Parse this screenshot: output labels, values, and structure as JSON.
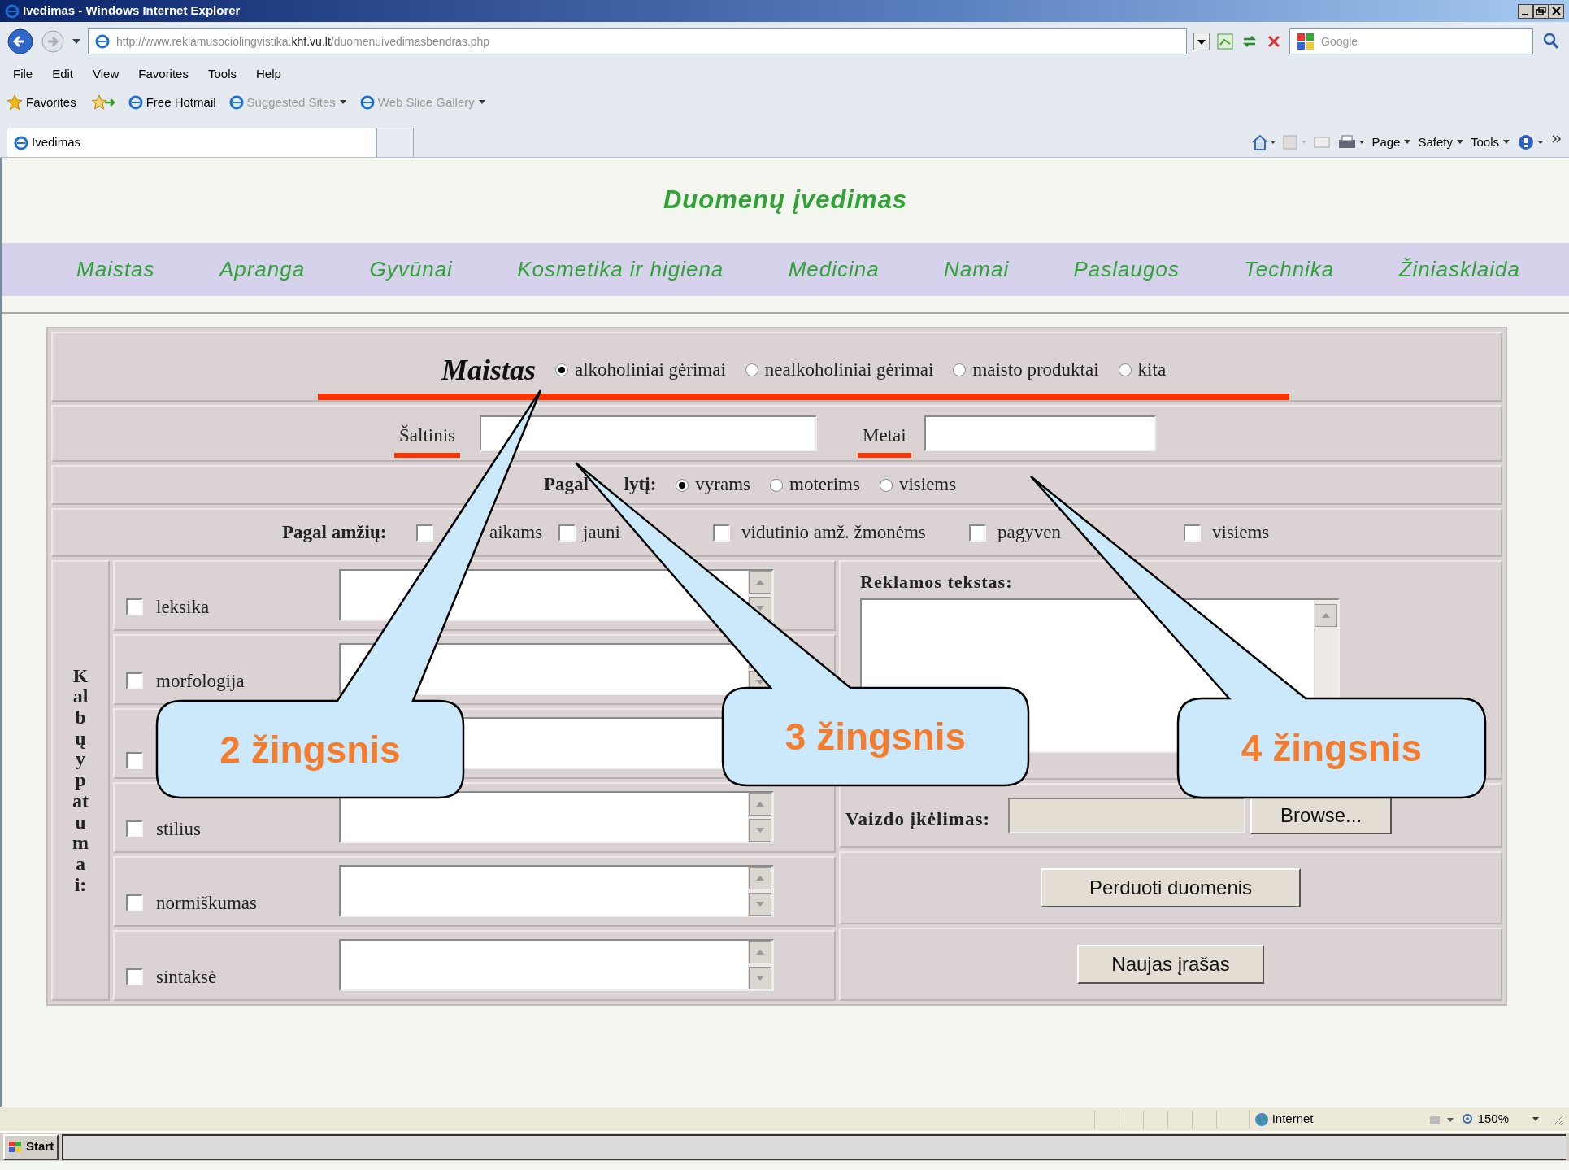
{
  "window": {
    "title": "Ivedimas - Windows Internet Explorer"
  },
  "address_bar": {
    "url": "http://www.reklamusociolingvistika.**khf.vu.lt**/duomenuivedimasbendras.php"
  },
  "search_field": {
    "placeholder": "Google"
  },
  "menu": [
    "File",
    "Edit",
    "View",
    "Favorites",
    "Tools",
    "Help"
  ],
  "favorites_bar": {
    "label": "Favorites",
    "links": [
      {
        "label": "Free Hotmail",
        "dimmed": false,
        "dropdown": false
      },
      {
        "label": "Suggested Sites",
        "dimmed": true,
        "dropdown": true
      },
      {
        "label": "Web Slice Gallery",
        "dimmed": true,
        "dropdown": true
      }
    ]
  },
  "tab": {
    "title": "Ivedimas"
  },
  "command_bar": [
    "Page",
    "Safety",
    "Tools"
  ],
  "page": {
    "heading": "Duomenų įvedimas",
    "nav": [
      "Maistas",
      "Apranga",
      "Gyvūnai",
      "Kosmetika ir higiena",
      "Medicina",
      "Namai",
      "Paslaugos",
      "Technika",
      "Žiniasklaida"
    ],
    "category": "Maistas",
    "category_options": [
      {
        "label": "alkoholiniai gėrimai",
        "selected": true
      },
      {
        "label": "nealkoholiniai gėrimai",
        "selected": false
      },
      {
        "label": "maisto produktai",
        "selected": false
      },
      {
        "label": "kita",
        "selected": false
      }
    ],
    "source_label": "Šaltinis",
    "year_label": "Metai",
    "gender": {
      "label": "Pagal lytį:",
      "options": [
        {
          "label": "vyrams",
          "selected": true
        },
        {
          "label": "moterims",
          "selected": false
        },
        {
          "label": "visiems",
          "selected": false
        }
      ]
    },
    "age": {
      "label": "Pagal amžių:",
      "options": [
        {
          "label": "aikams",
          "checked": false
        },
        {
          "label": "jauni",
          "checked": false
        },
        {
          "label": "vidutinio amž. žmonėms",
          "checked": false
        },
        {
          "label": "pagyven",
          "checked": false
        },
        {
          "label": "visiems",
          "checked": false
        }
      ]
    },
    "features": {
      "label": "Kalbų ypatumai:",
      "items": [
        {
          "label": "leksika",
          "checked": false
        },
        {
          "label": "morfologija",
          "checked": false
        },
        {
          "checked": false
        },
        {
          "label": "stilius",
          "checked": false
        },
        {
          "label": "normiškumas",
          "checked": false
        },
        {
          "label": "sintaksė",
          "checked": false
        }
      ]
    },
    "ad_text": {
      "label": "Reklamos tekstas:"
    },
    "upload": {
      "label": "Vaizdo įkėlimas:",
      "button": "Browse..."
    },
    "buttons": [
      "Perduoti duomenis",
      "Naujas įrašas"
    ]
  },
  "callouts": [
    {
      "label": "2 žingsnis"
    },
    {
      "label": "3 žingsnis"
    },
    {
      "label": "4 žingsnis"
    }
  ],
  "status_bar": {
    "zone": "Internet",
    "zoom": "150%"
  },
  "taskbar": {
    "start": "Start"
  }
}
